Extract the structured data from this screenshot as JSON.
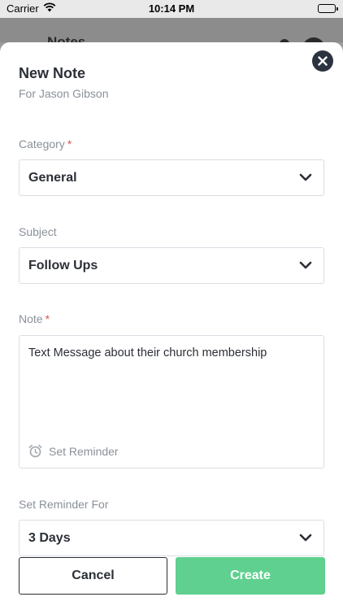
{
  "status_bar": {
    "carrier": "Carrier",
    "time": "10:14 PM"
  },
  "underlay": {
    "title": "Notes"
  },
  "modal": {
    "title": "New Note",
    "subtitle": "For Jason Gibson",
    "close_icon": "close-icon"
  },
  "form": {
    "category": {
      "label": "Category",
      "required_mark": "*",
      "value": "General"
    },
    "subject": {
      "label": "Subject",
      "value": "Follow Ups"
    },
    "note": {
      "label": "Note",
      "required_mark": "*",
      "value": "Text Message about their church membership",
      "reminder_label": "Set Reminder"
    },
    "reminder_for": {
      "label": "Set Reminder For",
      "value": "3 Days"
    }
  },
  "actions": {
    "cancel_label": "Cancel",
    "create_label": "Create"
  },
  "colors": {
    "accent_green": "#5fd08f",
    "required_red": "#e0524f",
    "text_dark": "#2b2f36",
    "text_muted": "#8a9199"
  }
}
